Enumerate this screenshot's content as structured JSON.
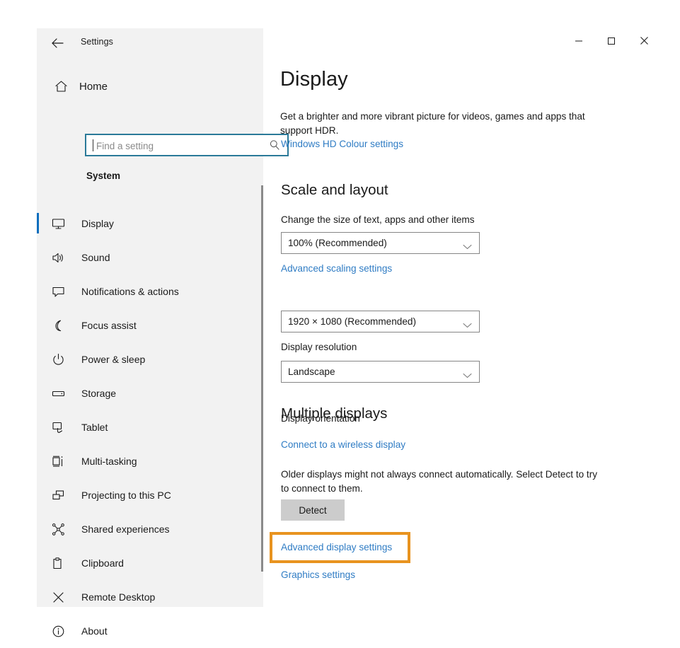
{
  "window": {
    "app_title": "Settings",
    "back_icon": "back-arrow-icon",
    "controls": {
      "minimize": "minimize-icon",
      "maximize": "maximize-icon",
      "close": "close-icon"
    }
  },
  "sidebar": {
    "home_label": "Home",
    "home_icon": "home-icon",
    "search": {
      "placeholder": "Find a setting",
      "value": "",
      "icon": "search-icon"
    },
    "group_heading": "System",
    "items": [
      {
        "label": "Display",
        "icon": "monitor-icon",
        "selected": true
      },
      {
        "label": "Sound",
        "icon": "speaker-icon",
        "selected": false
      },
      {
        "label": "Notifications & actions",
        "icon": "notification-icon",
        "selected": false
      },
      {
        "label": "Focus assist",
        "icon": "moon-icon",
        "selected": false
      },
      {
        "label": "Power & sleep",
        "icon": "power-icon",
        "selected": false
      },
      {
        "label": "Storage",
        "icon": "storage-icon",
        "selected": false
      },
      {
        "label": "Tablet",
        "icon": "tablet-icon",
        "selected": false
      },
      {
        "label": "Multi-tasking",
        "icon": "multitask-icon",
        "selected": false
      },
      {
        "label": "Projecting to this PC",
        "icon": "project-icon",
        "selected": false
      },
      {
        "label": "Shared experiences",
        "icon": "share-icon",
        "selected": false
      },
      {
        "label": "Clipboard",
        "icon": "clipboard-icon",
        "selected": false
      },
      {
        "label": "Remote Desktop",
        "icon": "remote-desktop-icon",
        "selected": false
      },
      {
        "label": "About",
        "icon": "info-icon",
        "selected": false
      }
    ]
  },
  "main": {
    "title": "Display",
    "hdr_description": "Get a brighter and more vibrant picture for videos, games and apps that support HDR.",
    "hd_colour_link": "Windows HD Colour settings",
    "scale_section": {
      "title": "Scale and layout",
      "scale_label": "Change the size of text, apps and other items",
      "scale_value": "100% (Recommended)",
      "advanced_scaling_link": "Advanced scaling settings",
      "resolution_label": "Display resolution",
      "resolution_value": "1920 × 1080 (Recommended)",
      "orientation_label": "Display orientation",
      "orientation_value": "Landscape"
    },
    "multiple_displays": {
      "title": "Multiple displays",
      "wireless_link": "Connect to a wireless display",
      "description": "Older displays might not always connect automatically. Select Detect to try to connect to them.",
      "detect_button": "Detect",
      "advanced_display_link": "Advanced display settings",
      "graphics_link": "Graphics settings"
    }
  },
  "colors": {
    "accent_blue": "#0a6ebd",
    "link_blue": "#2f7cc4",
    "highlight_orange": "#e8931f",
    "sidebar_bg": "#f2f2f2",
    "search_focus_border": "#2b7a99",
    "button_gray": "#cccccc"
  }
}
